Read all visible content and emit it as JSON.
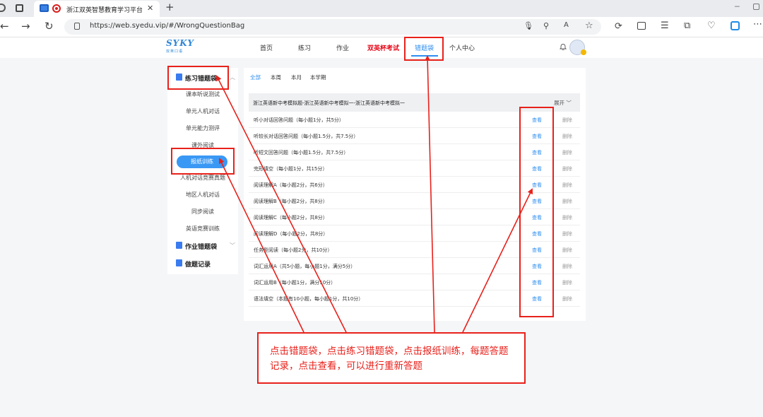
{
  "browser": {
    "tab_title": "浙江双英智慧教育学习平台",
    "url": "https://web.syedu.vip/#/WrongQuestionBag"
  },
  "header": {
    "logo_main": "SYKY",
    "logo_sub": "双英口语",
    "nav": [
      "首页",
      "练习",
      "作业",
      "双英杯考试",
      "错题袋",
      "个人中心"
    ],
    "active_nav": "错题袋",
    "highlight_nav": "双英杯考试"
  },
  "sidebar": {
    "practice_label": "练习错题袋",
    "practice_items": [
      "课本听说测试",
      "单元人机对话",
      "单元能力测评",
      "课外阅读",
      "报纸训练",
      "人机对话竞赛真题",
      "地区人机对话",
      "同步阅读",
      "英语竞赛训练"
    ],
    "active_item": "报纸训练",
    "homework_label": "作业错题袋",
    "record_label": "做题记录"
  },
  "main": {
    "filters": [
      "全部",
      "本周",
      "本月",
      "本学期"
    ],
    "active_filter": "全部",
    "group_title": "浙江英语新中考模拟题-浙江英语新中考模拟一-浙江英语新中考模拟一",
    "group_toggle": "展开",
    "view_label": "查看",
    "delete_label": "删除",
    "rows": [
      "听小对话回答问题（每小题1分，共5分）",
      "听较长对话回答问题（每小题1.5分，共7.5分）",
      "听短文回答问题（每小题1.5分，共7.5分）",
      "完形填空（每小题1分，共15分）",
      "阅读理解A（每小题2分，共6分）",
      "阅读理解B（每小题2分，共8分）",
      "阅读理解C（每小题2分，共8分）",
      "阅读理解D（每小题2分，共8分）",
      "任务型阅读（每小题2分，共10分）",
      "词汇运用A（共5小题，每小题1分，满分5分）",
      "词汇运用B（每小题1分，满分10分）",
      "语法填空（本题有10小题，每小题1分，共10分）"
    ]
  },
  "annotation": {
    "text": "点击错题袋，点击练习错题袋，点击报纸训练，每题答题记录，点击查看，可以进行重新答题",
    "color": "#e8211b"
  },
  "colors": {
    "accent": "#2e8ef0",
    "nav_highlight": "#e60012",
    "active_pill": "#3a98f5"
  }
}
